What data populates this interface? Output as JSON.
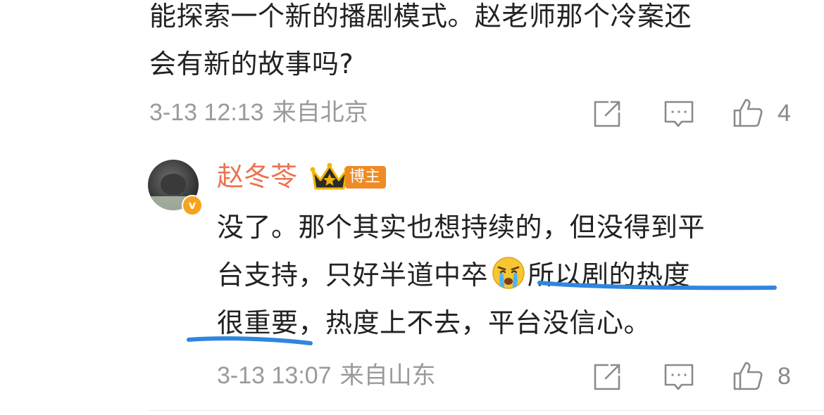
{
  "comment": {
    "text_line1": "能探索一个新的播剧模式。赵老师那个冷案还",
    "text_line2": "会有新的故事吗?",
    "time": "3-13 12:13",
    "location": "来自北京",
    "likes": "4"
  },
  "reply": {
    "username": "赵冬苓",
    "badge": "博主",
    "verified_mark": "v",
    "line1": "没了。那个其实也想持续的，但没得到平",
    "line2_a": "台支持，只好半道中卒",
    "line2_b": "所以剧的热度",
    "line3": "很重要，热度上不去，平台没信心。",
    "emoji": "crying-face",
    "time": "3-13 13:07",
    "location": "来自山东",
    "likes": "8"
  },
  "colors": {
    "username": "#eb7350",
    "badge_bg": "#f08a24",
    "meta": "#9a9a9a",
    "underline": "#2f86de",
    "verified": "#f7a31b"
  }
}
